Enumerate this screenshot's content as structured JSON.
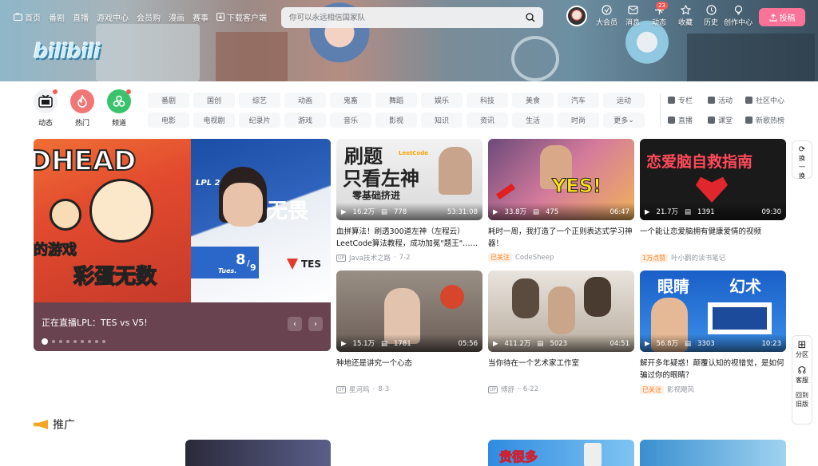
{
  "nav": {
    "items": [
      "首页",
      "番剧",
      "直播",
      "游戏中心",
      "会员购",
      "漫画",
      "赛事"
    ],
    "download": "下载客户端"
  },
  "search": {
    "placeholder": "你可以永远相信国家队"
  },
  "right_nav": [
    {
      "label": "大会员"
    },
    {
      "label": "消息"
    },
    {
      "label": "动态",
      "badge": "23"
    },
    {
      "label": "收藏"
    },
    {
      "label": "历史"
    },
    {
      "label": "创作中心"
    }
  ],
  "upload_label": "投稿",
  "logo_text": "bilibili",
  "channel_icons": [
    {
      "label": "动态"
    },
    {
      "label": "热门"
    },
    {
      "label": "频道"
    }
  ],
  "tags": [
    "番剧",
    "国创",
    "综艺",
    "动画",
    "鬼畜",
    "舞蹈",
    "娱乐",
    "科技",
    "美食",
    "汽车",
    "运动",
    "电影",
    "电视剧",
    "纪录片",
    "游戏",
    "音乐",
    "影视",
    "知识",
    "资讯",
    "生活",
    "时尚",
    "更多"
  ],
  "right_links": [
    "专栏",
    "活动",
    "社区中心",
    "直播",
    "课堂",
    "新歌热榜"
  ],
  "carousel": {
    "caption": "正在直播LPL：TES vs V5!",
    "left_text_1": "DHEAD",
    "left_text_2": "的游戏",
    "left_text_3": "彩蛋无数",
    "right_text_1": "LPL 2022",
    "right_text_2": "无畏",
    "date_day": "8",
    "date_month": "9",
    "date_weekday": "Tues.",
    "team": "TES"
  },
  "videos": [
    {
      "thumb_text_1": "刷题",
      "thumb_text_2": "只看左神",
      "thumb_text_3": "零基础挤进",
      "thumb_text_4": "LeetCode",
      "views": "16.2万",
      "danmaku": "778",
      "duration": "53:31:08",
      "title": "血拼算法！刷透300道左神（左程云）LeetCode算法教程，成功加冕\"题王\"……",
      "owner": "Java技术之路",
      "date": "7-2",
      "followed": ""
    },
    {
      "thumb_text_1": "YES!",
      "views": "33.8万",
      "danmaku": "475",
      "duration": "06:47",
      "title": "耗时一周，我打造了一个正则表达式学习神器！",
      "owner": "CodeSheep",
      "date": "",
      "followed": "已关注"
    },
    {
      "thumb_text_1": "恋爱脑自救指南",
      "views": "21.7万",
      "danmaku": "1391",
      "duration": "09:30",
      "title": "一个能让恋爱脑拥有健康爱情的视频",
      "owner": "叶小鹳的读书笔记",
      "date": "",
      "followed": "1万点赞"
    },
    {
      "views": "15.1万",
      "danmaku": "1781",
      "duration": "05:56",
      "title": "种地还是讲究一个心态",
      "owner": "星河鸣",
      "date": "8-3",
      "followed": ""
    },
    {
      "views": "411.2万",
      "danmaku": "5023",
      "duration": "04:51",
      "title": "当你待在一个艺术家工作室",
      "owner": "博舒",
      "date": "6-22",
      "followed": ""
    },
    {
      "thumb_text_1": "眼睛",
      "thumb_text_2": "幻术",
      "views": "56.8万",
      "danmaku": "3303",
      "duration": "10:23",
      "title": "解开多年疑惑！颠覆认知的视错觉，是如何骗过你的眼睛？",
      "owner": "影视飓风",
      "date": "",
      "followed": "已关注"
    }
  ],
  "float": {
    "refresh": "换一换",
    "zones": "分区",
    "service": "客服",
    "back": "回到旧版"
  },
  "promo": {
    "title": "推广"
  },
  "promo_thumb_text": "贵很多"
}
